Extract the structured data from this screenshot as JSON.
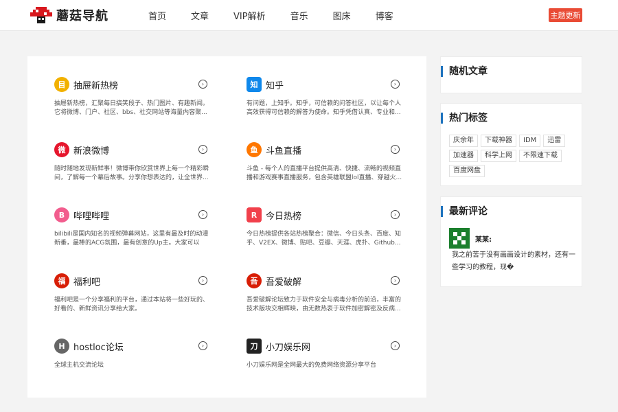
{
  "header": {
    "logo_text": "蘑菇导航",
    "nav": [
      "首页",
      "文章",
      "VIP解析",
      "音乐",
      "图床",
      "博客"
    ],
    "theme_button": "主题更新"
  },
  "cards": [
    {
      "title": "抽屉新热榜",
      "desc": "抽屉新热榜，汇聚每日搞笑段子、热门图片、有趣新闻。它将微博、门户、社区、bbs、社交网站等海量内容聚...",
      "icon": "drawer-icon",
      "color": "#f2b100"
    },
    {
      "title": "知乎",
      "desc": "有问题，上知乎。知乎，可信赖的问答社区，以让每个人高效获得可信赖的解答为使命。知乎凭借认真、专业和...",
      "icon": "zhihu-icon",
      "color": "#0f88eb"
    },
    {
      "title": "新浪微博",
      "desc": "随时随地发现新鲜事！微博带你欣赏世界上每一个精彩瞬间，了解每一个幕后故事。分享你想表达的，让全世界...",
      "icon": "weibo-icon",
      "color": "#e6162d"
    },
    {
      "title": "斗鱼直播",
      "desc": "斗鱼 - 每个人的直播平台提供高清、快捷、流畅的视频直播和游戏赛事直播服务，包含英雄联盟lol直播、穿越火...",
      "icon": "douyu-icon",
      "color": "#ff7700"
    },
    {
      "title": "哔哩哔哩",
      "desc": "bilibili是国内知名的视频弹幕网站，这里有最及时的动漫新番，最棒的ACG氛围，最有创意的Up主。大家可以在...",
      "icon": "bilibili-icon",
      "color": "#f25d8e"
    },
    {
      "title": "今日热榜",
      "desc": "今日热榜提供各站热榜聚合：微信、今日头条、百度、知乎、V2EX、微博、贴吧、豆瓣、天涯、虎扑、Github...",
      "icon": "tophub-icon",
      "color": "#f1404b"
    },
    {
      "title": "福利吧",
      "desc": "福利吧是一个分享福利的平台，通过本站将一些好玩的、好看的、新鲜资讯分享给大家。",
      "icon": "fuliba-icon",
      "color": "#d81e06"
    },
    {
      "title": "吾爱破解",
      "desc": "吾爱破解论坛致力于软件安全与病毒分析的前沿，丰富的技术版块交相辉映，由无数热衷于软件加密解密及反病...",
      "icon": "52pojie-icon",
      "color": "#d81e06"
    },
    {
      "title": "hostloc论坛",
      "desc": "全球主机交流论坛",
      "icon": "hostloc-icon",
      "color": "#666666"
    },
    {
      "title": "小刀娱乐网",
      "desc": "小刀娱乐网是全网最大的免费网络资源分享平台",
      "icon": "xiaodao-icon",
      "color": "#222222"
    }
  ],
  "card_glyphs": [
    "目",
    "知",
    "微",
    "鱼",
    "B",
    "R",
    "福",
    "吾",
    "H",
    "刀"
  ],
  "sidebar": {
    "random_title": "随机文章",
    "tags_title": "热门标签",
    "tags": [
      "庆余年",
      "下载神器",
      "IDM",
      "迅雷",
      "加速器",
      "科学上网",
      "不限速下载",
      "百度网盘"
    ],
    "comments_title": "最新评论",
    "comment_user": "某某:",
    "comment_text": "我之前苦于没有画画设计的素材，还有一些学习的教程，现�"
  },
  "colors": {
    "accent": "#1e73be",
    "theme_button": "#e94b35"
  }
}
